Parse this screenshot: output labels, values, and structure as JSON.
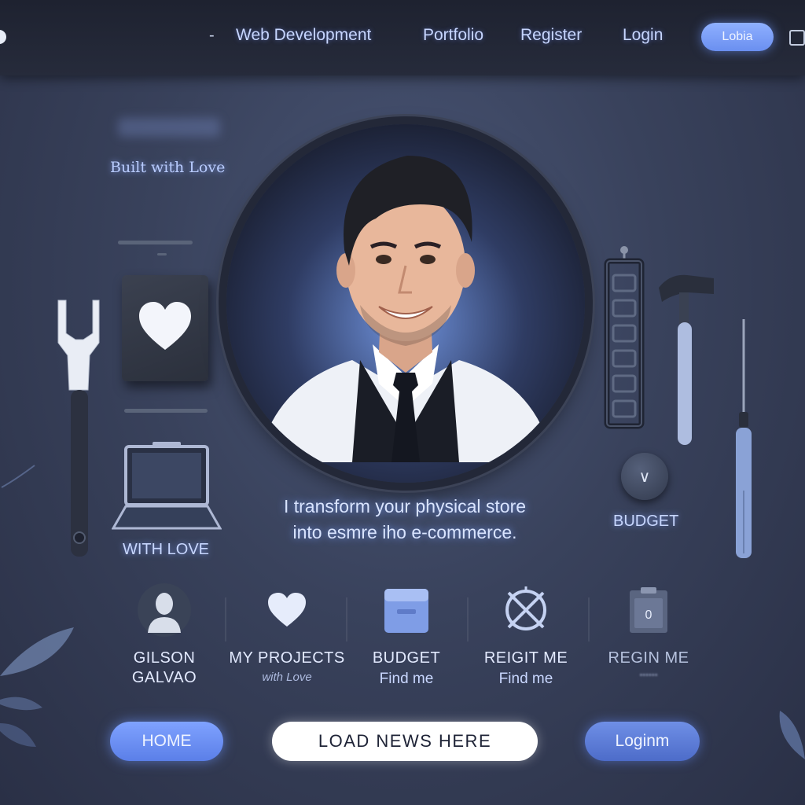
{
  "nav": {
    "dash": "-",
    "items": [
      "Web Development",
      "Portfolio",
      "Register",
      "Login"
    ],
    "cta": "Lobia"
  },
  "hero": {
    "tagline": "Built with Love",
    "left_caption": "WITH LOVE",
    "headline_line1": "I transform your physical store",
    "headline_line2": "into esmre iho e-commerce.",
    "budget_caption": "BUDGET",
    "budget_knob_symbol": "∨"
  },
  "features": [
    {
      "icon": "person-icon",
      "title": "GILSON",
      "subtitle": "GALVAO"
    },
    {
      "icon": "heart-icon",
      "title": "MY PROJECTS",
      "subtitle": "with Love"
    },
    {
      "icon": "bag-icon",
      "title": "BUDGET",
      "subtitle": "Find me"
    },
    {
      "icon": "crossed-circle-icon",
      "title": "REIGIT ME",
      "subtitle": "Find me"
    },
    {
      "icon": "clipboard-icon",
      "title": "REGIN ME",
      "subtitle": "••••••"
    }
  ],
  "buttons": {
    "home": "HOME",
    "load": "LOAD NEWS HERE",
    "login": "Loginm"
  },
  "colors": {
    "accent": "#6a8ff0",
    "background": "#39425c",
    "topbar": "#1e2230"
  }
}
